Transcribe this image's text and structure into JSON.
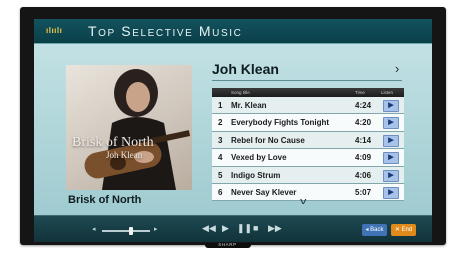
{
  "header": {
    "logo": "ılıılı",
    "title": "Top Selective Music"
  },
  "album": {
    "cover_title": "Brisk of North",
    "cover_artist": "Joh Klean",
    "name": "Brisk of North"
  },
  "artist": {
    "name": "Joh Klean",
    "more_icon": "chevron-right-icon"
  },
  "table": {
    "columns": {
      "title": "Song title",
      "time": "Time",
      "listen": "Listen"
    },
    "rows": [
      {
        "num": "1",
        "title": "Mr. Klean",
        "time": "4:24"
      },
      {
        "num": "2",
        "title": "Everybody Fights Tonight",
        "time": "4:20"
      },
      {
        "num": "3",
        "title": "Rebel for No Cause",
        "time": "4:14"
      },
      {
        "num": "4",
        "title": "Vexed by Love",
        "time": "4:09"
      },
      {
        "num": "5",
        "title": "Indigo Strum",
        "time": "4:06"
      },
      {
        "num": "6",
        "title": "Never Say Klever",
        "time": "5:07"
      }
    ],
    "listen_icon": "speaker-icon",
    "scroll_icon": "chevron-down-icon"
  },
  "footer": {
    "volume_down_icon": "◂",
    "volume_up_icon": "▸",
    "controls": {
      "rewind": "◀◀",
      "play": "▶",
      "pause": "❚❚",
      "stop": "■",
      "forward": "▶▶"
    },
    "back_label": "◂ Back",
    "end_label": "✕ End"
  },
  "bezel": {
    "brand": "SHARP"
  },
  "colors": {
    "header": "#0b3f48",
    "content": "#9ec8cd",
    "back": "#3f73b6",
    "end": "#e08a1c"
  }
}
